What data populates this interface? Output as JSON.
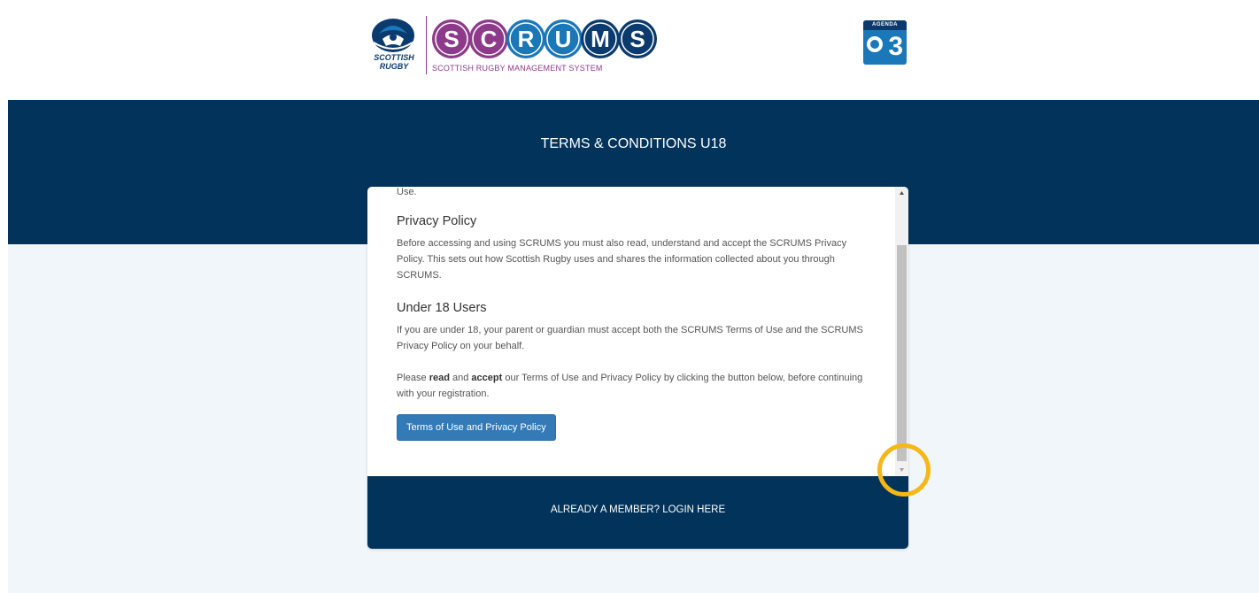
{
  "header": {
    "logo_text_line1": "SCOTTISH",
    "logo_text_line2": "RUGBY",
    "scrums_letters": [
      "S",
      "C",
      "R",
      "U",
      "M",
      "S"
    ],
    "scrums_subtitle": "SCOTTISH RUGBY MANAGEMENT SYSTEM",
    "agenda_label": "AGENDA",
    "agenda_number": "3"
  },
  "band": {
    "title": "TERMS & CONDITIONS U18"
  },
  "content": {
    "partial_text": "Use.",
    "privacy_heading": "Privacy Policy",
    "privacy_text": "Before accessing and using SCRUMS you must also read, understand and accept the SCRUMS Privacy Policy. This sets out how Scottish Rugby uses and shares the information collected about you through SCRUMS.",
    "under18_heading": "Under 18 Users",
    "under18_text": "If you are under 18, your parent or guardian must accept both the SCRUMS Terms of Use and the SCRUMS Privacy Policy on your behalf.",
    "instruction_prefix": "Please ",
    "instruction_read": "read",
    "instruction_and": " and ",
    "instruction_accept": "accept",
    "instruction_suffix": " our Terms of Use and Privacy Policy by clicking the button below, before continuing with your registration.",
    "button_label": "Terms of Use and Privacy Policy"
  },
  "footer": {
    "login_label": "ALREADY A MEMBER? LOGIN HERE"
  },
  "colors": {
    "navy": "#02335a",
    "purple": "#8e3a8b",
    "blue": "#1a77b8",
    "button": "#337ab7",
    "highlight": "#f6b717"
  }
}
